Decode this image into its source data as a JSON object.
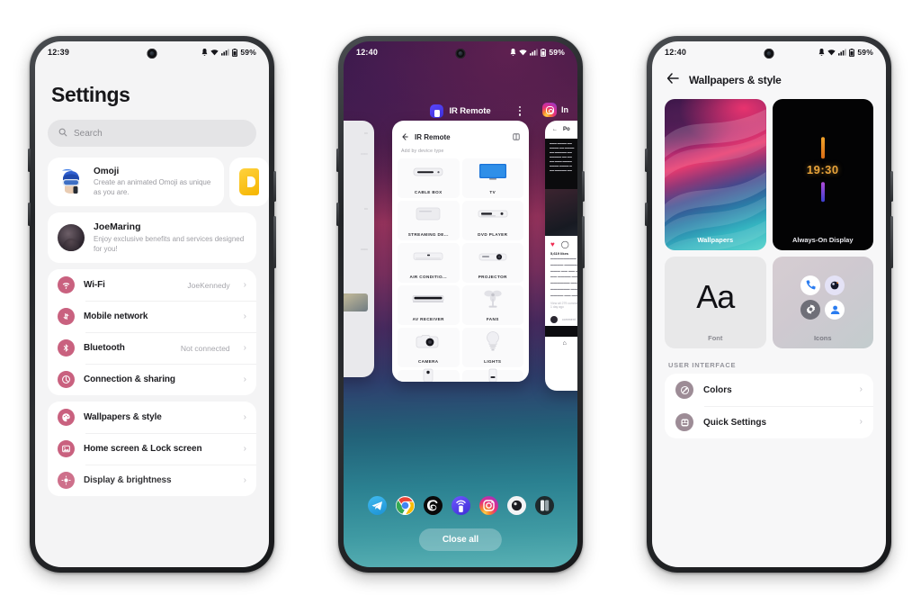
{
  "phones": [
    {
      "id": "phone-settings",
      "status_bar": {
        "time": "12:39",
        "battery": "59%",
        "icons": [
          "mute-icon",
          "wifi-icon",
          "signal-icon",
          "battery-icon"
        ]
      },
      "title": "Settings",
      "search": {
        "placeholder": "Search",
        "icon": "search-icon"
      },
      "omoji_card": {
        "title": "Omoji",
        "description": "Create an animated Omoji as unique as you are.",
        "avatar": "omoji-avatar"
      },
      "profile_card": {
        "name": "JoeMaring",
        "description": "Enjoy exclusive benefits and services designed for you!",
        "avatar": "profile-avatar"
      },
      "groups": [
        {
          "rows": [
            {
              "label": "Wi-Fi",
              "value": "JoeKennedy",
              "icon": "wifi-icon"
            },
            {
              "label": "Mobile network",
              "value": "",
              "icon": "sim-card-icon"
            },
            {
              "label": "Bluetooth",
              "value": "Not connected",
              "icon": "bluetooth-icon"
            },
            {
              "label": "Connection & sharing",
              "value": "",
              "icon": "connection-sharing-icon"
            }
          ]
        },
        {
          "rows": [
            {
              "label": "Wallpapers & style",
              "value": "",
              "icon": "wallpapers-style-icon"
            },
            {
              "label": "Home screen & Lock screen",
              "value": "",
              "icon": "home-lock-screen-icon"
            },
            {
              "label": "Display & brightness",
              "value": "",
              "icon": "display-brightness-icon"
            }
          ]
        }
      ]
    },
    {
      "id": "phone-recents",
      "status_bar": {
        "time": "12:40",
        "battery": "59%",
        "icons": [
          "mute-icon",
          "wifi-icon",
          "signal-icon",
          "battery-icon"
        ]
      },
      "focused_task": {
        "app_name": "IR Remote",
        "icon": "ir-remote-icon",
        "menu": "kebab-menu-icon"
      },
      "right_task": {
        "app_name": "In",
        "icon": "instagram-icon"
      },
      "ir_app": {
        "back": "back-arrow-icon",
        "title": "IR Remote",
        "action": "split-screen-icon",
        "subtitle": "Add by device type",
        "devices": [
          {
            "name": "CABLE BOX",
            "icon": "cable-box-icon"
          },
          {
            "name": "TV",
            "icon": "tv-icon"
          },
          {
            "name": "STREAMING DE...",
            "icon": "streaming-device-icon"
          },
          {
            "name": "DVD PLAYER",
            "icon": "dvd-player-icon"
          },
          {
            "name": "AIR CONDITIO...",
            "icon": "air-conditioner-icon"
          },
          {
            "name": "PROJECTOR",
            "icon": "projector-icon"
          },
          {
            "name": "AV RECEIVER",
            "icon": "av-receiver-icon"
          },
          {
            "name": "FANS",
            "icon": "fan-icon"
          },
          {
            "name": "CAMERA",
            "icon": "camera-icon"
          },
          {
            "name": "LIGHTS",
            "icon": "light-bulb-icon"
          },
          {
            "name": "",
            "icon": "air-purifier-icon"
          },
          {
            "name": "",
            "icon": "water-heater-icon"
          }
        ]
      },
      "dock": [
        "telegram-icon",
        "chrome-icon",
        "threads-icon",
        "ir-remote-icon",
        "instagram-icon",
        "camera-icon",
        "gallery-icon"
      ],
      "close_all_label": "Close all"
    },
    {
      "id": "phone-wallpapers",
      "status_bar": {
        "time": "12:40",
        "battery": "59%",
        "icons": [
          "mute-icon",
          "wifi-icon",
          "signal-icon",
          "battery-icon"
        ]
      },
      "back": "back-arrow-icon",
      "title": "Wallpapers & style",
      "style_cards": [
        {
          "label": "Wallpapers",
          "kind": "wallpaper-preview"
        },
        {
          "label": "Always-On Display",
          "kind": "aod-preview",
          "clock": "19:30"
        },
        {
          "label": "Font",
          "kind": "font-preview",
          "sample": "Aa"
        },
        {
          "label": "Icons",
          "kind": "icons-preview"
        }
      ],
      "section_label": "USER INTERFACE",
      "ui_rows": [
        {
          "label": "Colors",
          "icon": "colors-icon"
        },
        {
          "label": "Quick Settings",
          "icon": "quick-settings-icon"
        }
      ]
    }
  ],
  "colors": {
    "settings_icon_pink": "#c9617f",
    "ui_icon_mauve": "#9d8c96",
    "accent_yellow": "#f5b500",
    "aod_amber": "#e8a33a",
    "page_background": "#ffffff"
  }
}
